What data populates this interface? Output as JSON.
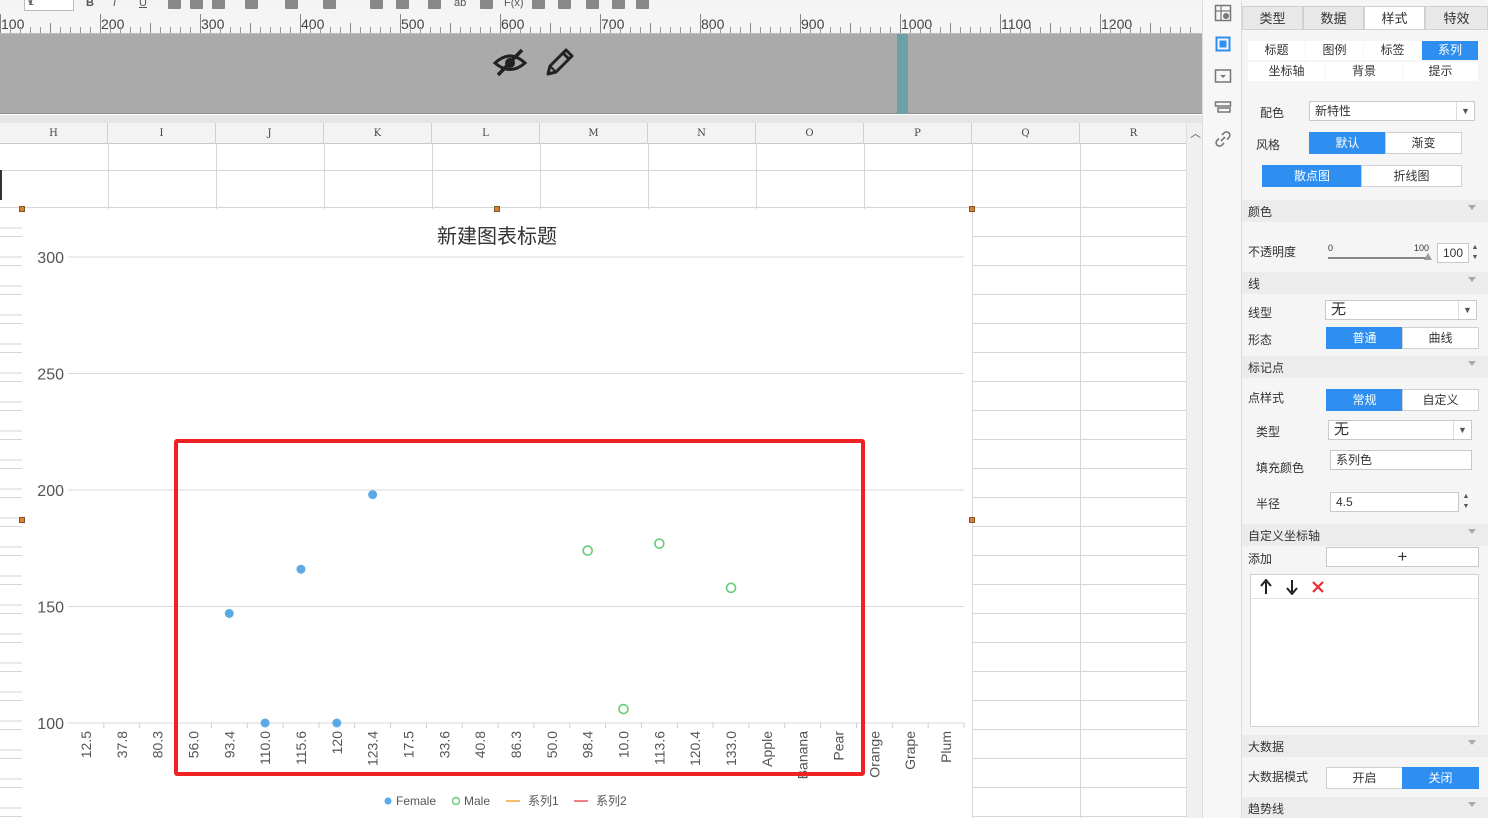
{
  "toolbar": {
    "font_size_value": "1",
    "bold_label": "B",
    "italic_label": "I",
    "underline_label": "U",
    "text_label": "ab",
    "formula_label": "F(x)"
  },
  "ruler": {
    "labels": [
      "100",
      "200",
      "300",
      "400",
      "500",
      "600",
      "700",
      "800",
      "900",
      "1000",
      "1100",
      "1200"
    ]
  },
  "columns": [
    "H",
    "I",
    "J",
    "K",
    "L",
    "M",
    "N",
    "O",
    "P",
    "Q",
    "R"
  ],
  "chart_data": {
    "type": "scatter",
    "title": "新建图表标题",
    "ylim": [
      100,
      300
    ],
    "yticks": [
      100,
      150,
      200,
      250,
      300
    ],
    "categories": [
      "12.5",
      "37.8",
      "80.3",
      "56.0",
      "93.4",
      "110.0",
      "115.6",
      "120",
      "123.4",
      "17.5",
      "33.6",
      "40.8",
      "86.3",
      "50.0",
      "98.4",
      "10.0",
      "113.6",
      "120.4",
      "133.0",
      "Apple",
      "Banana",
      "Pear",
      "Orange",
      "Grape",
      "Plum"
    ],
    "series": [
      {
        "name": "Female",
        "style": "filled",
        "color": "#5aaae8",
        "points": [
          {
            "x": "93.4",
            "y": 147
          },
          {
            "x": "110.0",
            "y": 100
          },
          {
            "x": "115.6",
            "y": 166
          },
          {
            "x": "120",
            "y": 100
          },
          {
            "x": "123.4",
            "y": 198
          }
        ]
      },
      {
        "name": "Male",
        "style": "hollow",
        "color": "#66cc77",
        "points": [
          {
            "x": "98.4",
            "y": 174
          },
          {
            "x": "10.0",
            "y": 106
          },
          {
            "x": "113.6",
            "y": 177
          },
          {
            "x": "133.0",
            "y": 158
          }
        ]
      }
    ],
    "legend": [
      {
        "name": "Female",
        "kind": "dot",
        "color": "#5aaae8"
      },
      {
        "name": "Male",
        "kind": "ring",
        "color": "#66cc77"
      },
      {
        "name": "系列1",
        "kind": "line",
        "color": "#f5a94a"
      },
      {
        "name": "系列2",
        "kind": "line",
        "color": "#f06060"
      }
    ],
    "legend_position": "bottom",
    "grid": true
  },
  "strip_icons": [
    "chart-type-icon",
    "chart-select-icon",
    "chart-frame-icon",
    "layers-icon",
    "link-icon"
  ],
  "panel": {
    "main_tabs": [
      "类型",
      "数据",
      "样式",
      "特效"
    ],
    "sub_tabs_row1": [
      "标题",
      "图例",
      "标签",
      "系列"
    ],
    "sub_tabs_row2": [
      "坐标轴",
      "背景",
      "提示"
    ],
    "color_scheme_label": "配色",
    "color_scheme_value": "新特性",
    "style_label": "风格",
    "style_options": [
      "默认",
      "渐变"
    ],
    "chart_kind_options": [
      "散点图",
      "折线图"
    ],
    "section_color": "颜色",
    "opacity_label": "不透明度",
    "opacity_min": "0",
    "opacity_max": "100",
    "opacity_value": "100",
    "section_line": "线",
    "line_type_label": "线型",
    "line_type_value": "无",
    "shape_label": "形态",
    "shape_options": [
      "普通",
      "曲线"
    ],
    "section_marker": "标记点",
    "marker_style_label": "点样式",
    "marker_style_options": [
      "常规",
      "自定义"
    ],
    "marker_type_label": "类型",
    "marker_type_value": "无",
    "fill_color_label": "填充颜色",
    "fill_color_value": "系列色",
    "radius_label": "半径",
    "radius_value": "4.5",
    "section_custom_axis": "自定义坐标轴",
    "add_label": "添加",
    "add_symbol": "+",
    "section_big_data": "大数据",
    "big_data_mode_label": "大数据模式",
    "big_data_options": [
      "开启",
      "关闭"
    ],
    "section_trendline": "趋势线"
  }
}
